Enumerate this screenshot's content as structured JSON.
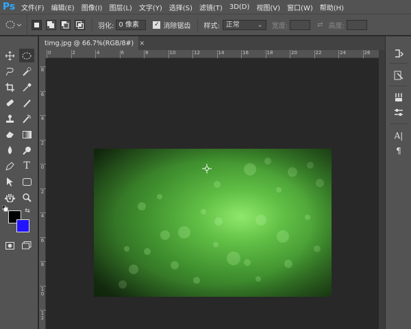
{
  "app": {
    "logo": "Ps"
  },
  "menu": [
    "文件(F)",
    "编辑(E)",
    "图像(I)",
    "图层(L)",
    "文字(Y)",
    "选择(S)",
    "滤镜(T)",
    "3D(D)",
    "视图(V)",
    "窗口(W)",
    "帮助(H)"
  ],
  "options": {
    "tool_icon": "elliptical-marquee-icon",
    "feather_label": "羽化:",
    "feather_value": "0 像素",
    "antialias_label": "消除锯齿",
    "antialias_checked": true,
    "style_label": "样式:",
    "style_value": "正常",
    "width_label": "宽度:",
    "height_label": "高度:"
  },
  "document": {
    "tab_title": "timg.jpg @ 66.7%(RGB/8#)",
    "close_glyph": "×"
  },
  "rulers": {
    "horizontal": [
      "0",
      "2",
      "4",
      "6",
      "8",
      "10",
      "12",
      "14",
      "16",
      "18",
      "20",
      "22",
      "24",
      "26"
    ],
    "vertical": [
      "8",
      "6",
      "4",
      "2",
      "0",
      "2",
      "4",
      "6",
      "8",
      "1 0",
      "1 2",
      "1 4"
    ]
  },
  "colors": {
    "foreground": "#000000",
    "background": "#2314ff",
    "ui_panel": "#535353",
    "workspace": "#282828"
  },
  "toolbar": {
    "tools": [
      "move-icon",
      "elliptical-marquee-icon",
      "lasso-icon",
      "quick-selection-icon",
      "crop-icon",
      "eyedropper-icon",
      "healing-brush-icon",
      "brush-icon",
      "clone-stamp-icon",
      "history-brush-icon",
      "eraser-icon",
      "gradient-icon",
      "blur-icon",
      "dodge-icon",
      "pen-icon",
      "type-icon",
      "path-selection-icon",
      "rectangle-icon",
      "hand-icon",
      "zoom-icon",
      "more-tools-icon",
      "quick-mask-icon",
      "screen-mode-icon"
    ],
    "type_glyph": "T",
    "more_glyph": "•••"
  },
  "dock": {
    "icons": [
      "history-panel-icon",
      "properties-panel-icon",
      "brush-settings-icon",
      "adjustments-icon",
      "character-panel-icon",
      "paragraph-panel-icon"
    ],
    "character_glyph": "A|",
    "paragraph_glyph": "¶"
  }
}
